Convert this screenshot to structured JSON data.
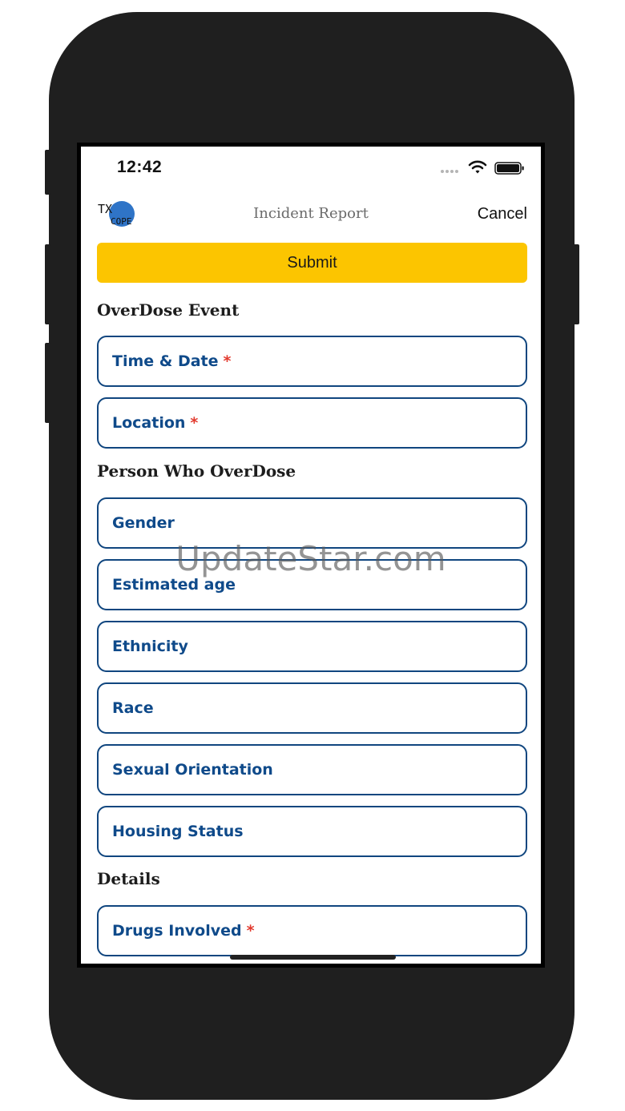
{
  "status_bar": {
    "time": "12:42",
    "icons": [
      "signal-icon",
      "wifi-icon",
      "battery-icon"
    ]
  },
  "header": {
    "logo_text_top": "TX",
    "logo_text_bottom": "COPE",
    "title": "Incident Report",
    "cancel_label": "Cancel"
  },
  "submit_label": "Submit",
  "sections": {
    "overdose_event": {
      "heading": "OverDose Event",
      "fields": [
        {
          "label": "Time & Date",
          "required_mark": "*"
        },
        {
          "label": "Location",
          "required_mark": "*"
        }
      ]
    },
    "person": {
      "heading": "Person Who OverDose",
      "fields": [
        {
          "label": "Gender"
        },
        {
          "label": "Estimated age"
        },
        {
          "label": "Ethnicity"
        },
        {
          "label": "Race"
        },
        {
          "label": "Sexual Orientation"
        },
        {
          "label": "Housing Status"
        }
      ]
    },
    "details": {
      "heading": "Details",
      "fields": [
        {
          "label": "Drugs Involved",
          "required_mark": "*"
        }
      ]
    }
  },
  "watermark": "UpdateStar.com",
  "colors": {
    "accent_button": "#fcc500",
    "field_border": "#10467f",
    "field_label": "#0f4a8a",
    "required": "#e23a2e"
  }
}
